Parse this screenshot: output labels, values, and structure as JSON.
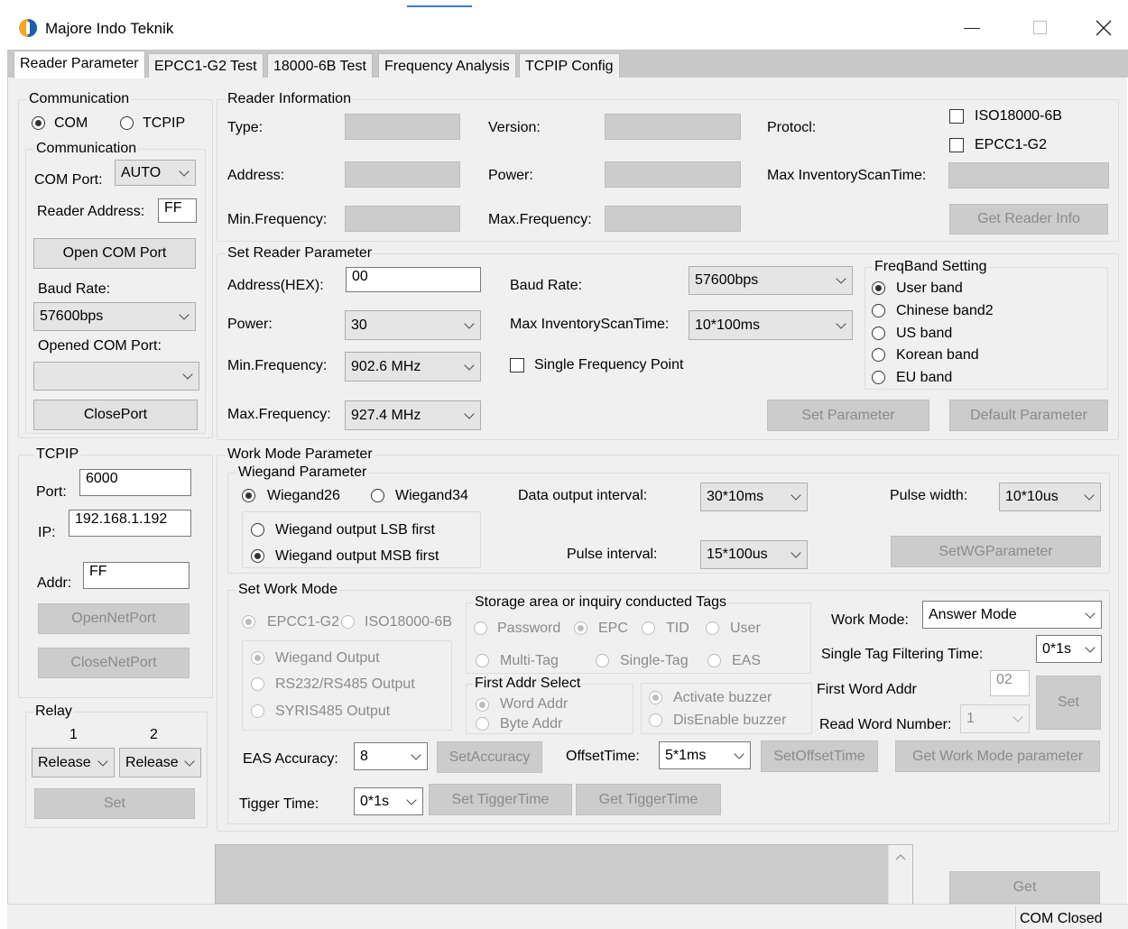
{
  "window": {
    "title": "Majore Indo Teknik"
  },
  "tabs": [
    "Reader Parameter",
    "EPCC1-G2 Test",
    "18000-6B Test",
    "Frequency Analysis",
    "TCPIP Config"
  ],
  "communication": {
    "title": "Communication",
    "radio_com": "COM",
    "radio_tcpip": "TCPIP",
    "sub_title": "Communication",
    "com_port_label": "COM Port:",
    "com_port_value": "AUTO",
    "reader_address_label": "Reader Address:",
    "reader_address_value": "FF",
    "open_com_button": "Open COM Port",
    "baud_rate_label": "Baud Rate:",
    "baud_rate_value": "57600bps",
    "opened_com_label": "Opened COM Port:",
    "opened_com_value": "",
    "close_port_button": "ClosePort"
  },
  "tcpip": {
    "title": "TCPIP",
    "port_label": "Port:",
    "port_value": "6000",
    "ip_label": "IP:",
    "ip_value": "192.168.1.192",
    "addr_label": "Addr:",
    "addr_value": "FF",
    "open_net_button": "OpenNetPort",
    "close_net_button": "CloseNetPort"
  },
  "relay": {
    "title": "Relay",
    "col1": "1",
    "col2": "2",
    "relay1_value": "Release",
    "relay2_value": "Release",
    "set_button": "Set"
  },
  "reader_info": {
    "title": "Reader Information",
    "type_label": "Type:",
    "version_label": "Version:",
    "protocol_label": "Protocl:",
    "iso_label": "ISO18000-6B",
    "epc_label": "EPCC1-G2",
    "address_label": "Address:",
    "power_label": "Power:",
    "max_inv_label": "Max InventoryScanTime:",
    "min_freq_label": "Min.Frequency:",
    "max_freq_label": "Max.Frequency:",
    "get_info_button": "Get Reader Info"
  },
  "set_reader": {
    "title": "Set Reader Parameter",
    "address_label": "Address(HEX):",
    "address_value": "00",
    "baud_label": "Baud Rate:",
    "baud_value": "57600bps",
    "power_label": "Power:",
    "power_value": "30",
    "max_inv_label": "Max InventoryScanTime:",
    "max_inv_value": "10*100ms",
    "min_freq_label": "Min.Frequency:",
    "min_freq_value": "902.6 MHz",
    "single_freq_label": "Single Frequency Point",
    "max_freq_label": "Max.Frequency:",
    "max_freq_value": "927.4 MHz",
    "set_param_button": "Set Parameter",
    "default_param_button": "Default Parameter"
  },
  "freqband": {
    "title": "FreqBand Setting",
    "options": [
      "User band",
      "Chinese band2",
      "US band",
      "Korean band",
      "EU band"
    ],
    "selected": "User band"
  },
  "work_mode": {
    "title": "Work Mode Parameter",
    "wiegand_title": "Wiegand Parameter",
    "wiegand26": "Wiegand26",
    "wiegand34": "Wiegand34",
    "lsb_first": "Wiegand output LSB first",
    "msb_first": "Wiegand output MSB first",
    "data_interval_label": "Data output interval:",
    "data_interval_value": "30*10ms",
    "pulse_width_label": "Pulse width:",
    "pulse_width_value": "10*10us",
    "pulse_interval_label": "Pulse interval:",
    "pulse_interval_value": "15*100us",
    "set_wg_button": "SetWGParameter",
    "set_mode_title": "Set Work Mode",
    "proto_epc": "EPCC1-G2",
    "proto_iso": "ISO18000-6B",
    "wiegand_output": "Wiegand Output",
    "rs232_output": "RS232/RS485 Output",
    "syris_output": "SYRIS485 Output",
    "storage_title": "Storage area or inquiry conducted Tags",
    "st_password": "Password",
    "st_epc": "EPC",
    "st_tid": "TID",
    "st_user": "User",
    "st_multi": "Multi-Tag",
    "st_single": "Single-Tag",
    "st_eas": "EAS",
    "first_addr_title": "First Addr Select",
    "word_addr": "Word Addr",
    "byte_addr": "Byte Addr",
    "activate_buzzer": "Activate buzzer",
    "disable_buzzer": "DisEnable buzzer",
    "work_mode_label": "Work Mode:",
    "work_mode_value": "Answer Mode",
    "single_filter_label": "Single Tag Filtering Time:",
    "single_filter_value": "0*1s",
    "first_word_label": "First Word Addr",
    "first_word_value": "02",
    "read_word_label": "Read Word Number:",
    "read_word_value": "1",
    "set_button": "Set",
    "eas_label": "EAS Accuracy:",
    "eas_value": "8",
    "set_accuracy_button": "SetAccuracy",
    "offset_label": "OffsetTime:",
    "offset_value": "5*1ms",
    "set_offset_button": "SetOffsetTime",
    "get_work_mode_button": "Get Work Mode parameter",
    "tigger_label": "Tigger Time:",
    "tigger_value": "0*1s",
    "set_tigger_button": "Set TiggerTime",
    "get_tigger_button": "Get TiggerTime"
  },
  "bottom": {
    "get_button": "Get",
    "status": "COM Closed"
  }
}
